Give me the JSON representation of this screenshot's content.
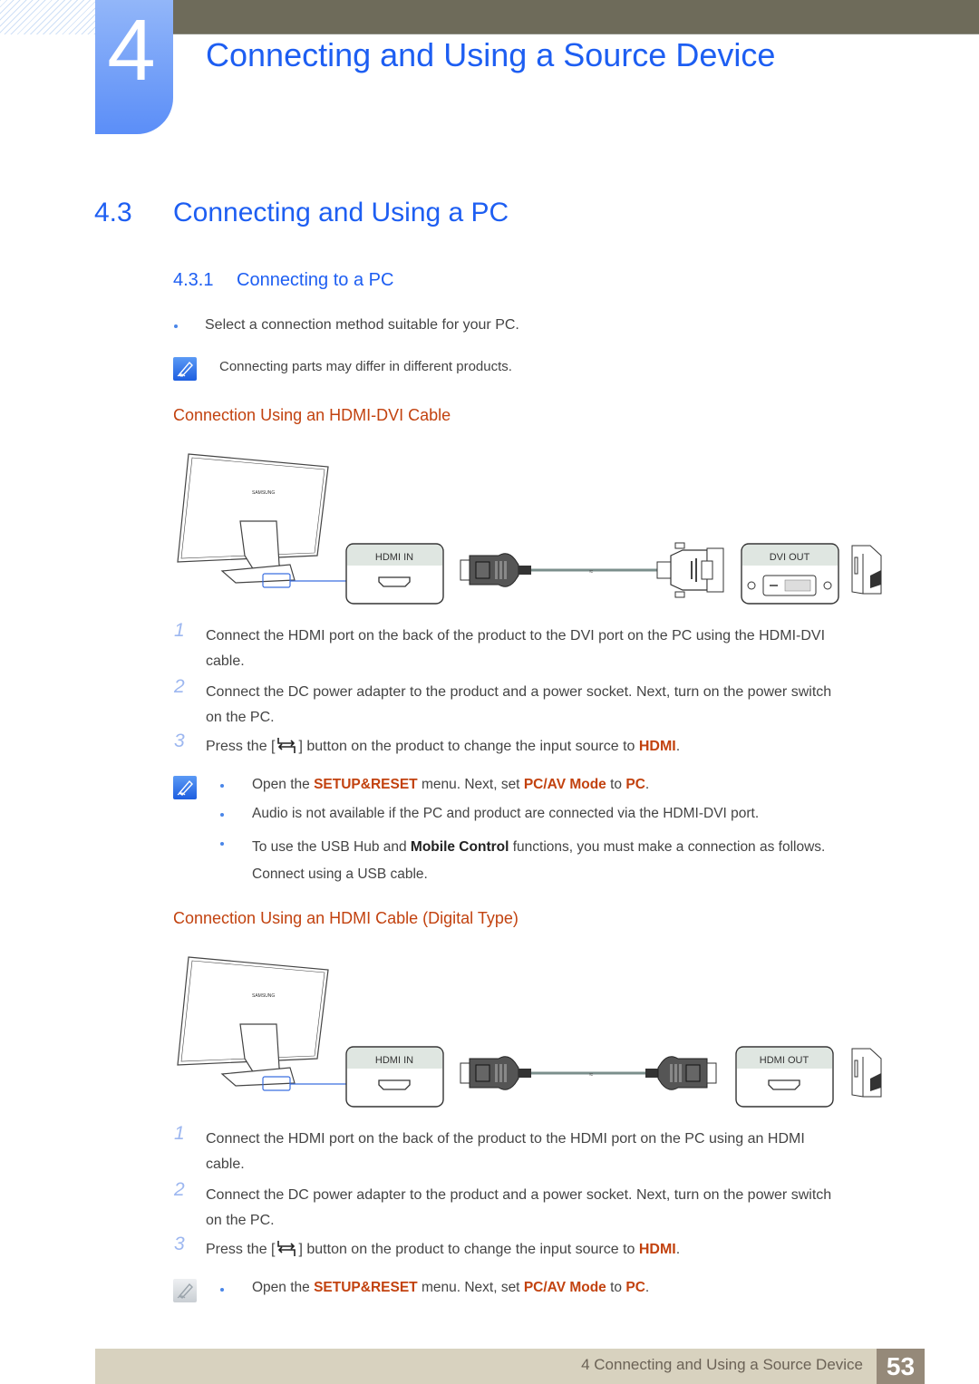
{
  "header": {
    "chapter_number": "4",
    "chapter_title": "Connecting and Using a Source Device"
  },
  "section": {
    "number": "4.3",
    "title": "Connecting and Using a PC"
  },
  "subsection": {
    "number": "4.3.1",
    "title": "Connecting to a PC"
  },
  "intro_bullet": "Select a connection method suitable for your PC.",
  "intro_note": "Connecting parts may differ in different products.",
  "methods": [
    {
      "title": "Connection Using an HDMI-DVI Cable",
      "diagram": {
        "monitor_brand": "SAMSUNG",
        "input_label": "HDMI IN",
        "output_label": "DVI OUT"
      },
      "steps": [
        {
          "num": "1",
          "text_a": "Connect the HDMI port on the back of the product to the DVI port on the PC using the HDMI-DVI",
          "text_b": "cable."
        },
        {
          "num": "2",
          "text_a": "Connect the DC power adapter to the product and a power socket. Next, turn on the power switch",
          "text_b": "on the PC."
        },
        {
          "num": "3",
          "pre": "Press the [",
          "post": "] button on the product to change the input source to ",
          "hl": "HDMI",
          "end": "."
        }
      ],
      "notes": [
        {
          "pre": "Open the ",
          "hl1": "SETUP&RESET",
          "mid": " menu. Next, set ",
          "hl2": "PC/AV Mode",
          "mid2": " to ",
          "hl3": "PC",
          "end": "."
        },
        {
          "text": "Audio is not available if the PC and product are connected via the HDMI-DVI port."
        },
        {
          "pre": "To use the USB Hub and ",
          "bold": "Mobile Control",
          "post": " functions, you must make a connection as follows.",
          "line2": "Connect using a USB cable."
        }
      ]
    },
    {
      "title": "Connection Using an HDMI Cable (Digital Type)",
      "diagram": {
        "monitor_brand": "SAMSUNG",
        "input_label": "HDMI IN",
        "output_label": "HDMI OUT"
      },
      "steps": [
        {
          "num": "1",
          "text_a": "Connect the HDMI port on the back of the product to the HDMI port on the PC using an HDMI",
          "text_b": "cable."
        },
        {
          "num": "2",
          "text_a": "Connect the DC power adapter to the product and a power socket. Next, turn on the power switch",
          "text_b": "on the PC."
        },
        {
          "num": "3",
          "pre": "Press the [",
          "post": "] button on the product to change the input source to ",
          "hl": "HDMI",
          "end": "."
        }
      ],
      "notes": [
        {
          "pre": "Open the ",
          "hl1": "SETUP&RESET",
          "mid": " menu. Next, set ",
          "hl2": "PC/AV Mode",
          "mid2": " to ",
          "hl3": "PC",
          "end": "."
        }
      ]
    }
  ],
  "footer": {
    "chapter_ref": "4 Connecting and Using a Source Device",
    "page_number": "53"
  }
}
